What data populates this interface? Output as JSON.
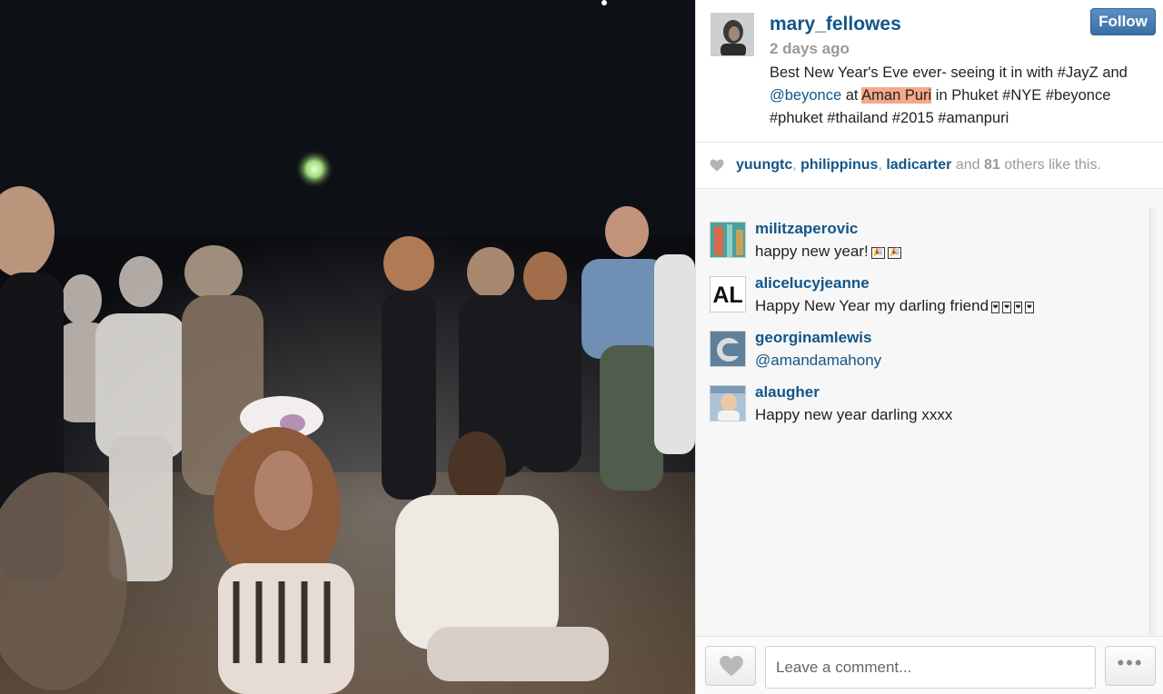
{
  "post": {
    "username": "mary_fellowes",
    "time_ago": "2 days ago",
    "follow_label": "Follow",
    "caption": {
      "part1": "Best New Year's Eve ever- seeing it in with #JayZ and ",
      "mention": "@beyonce",
      "part2": " at ",
      "place": "Aman Puri",
      "part3": " in Phuket #NYE #beyonce #phuket #thailand #2015 #amanpuri"
    }
  },
  "likes": {
    "user1": "yuungtc",
    "sep1": ", ",
    "user2": "philippinus",
    "sep2": ", ",
    "user3": "ladicarter",
    "and": " and ",
    "count": "81",
    "others": " others like this."
  },
  "comments": [
    {
      "user": "militzaperovic",
      "text": "happy new year!",
      "emoji": [
        "🎉",
        "🎉"
      ]
    },
    {
      "user": "alicelucyjeanne",
      "text": "Happy New Year my darling friend",
      "emoji": [
        "❤",
        "❤",
        "❤",
        "❤"
      ],
      "avatar_text": "AL"
    },
    {
      "user": "georginamlewis",
      "text": "@amandamahony"
    },
    {
      "user": "alaugher",
      "text": "Happy new year darling xxxx"
    }
  ],
  "footer": {
    "comment_placeholder": "Leave a comment...",
    "more_label": "•••"
  },
  "colors": {
    "link": "#125688",
    "highlight": "#f5a98a",
    "follow_button": "#3a6ea5",
    "muted": "#9a9a9a"
  },
  "icons": [
    "heart-icon",
    "more-dots-icon"
  ]
}
